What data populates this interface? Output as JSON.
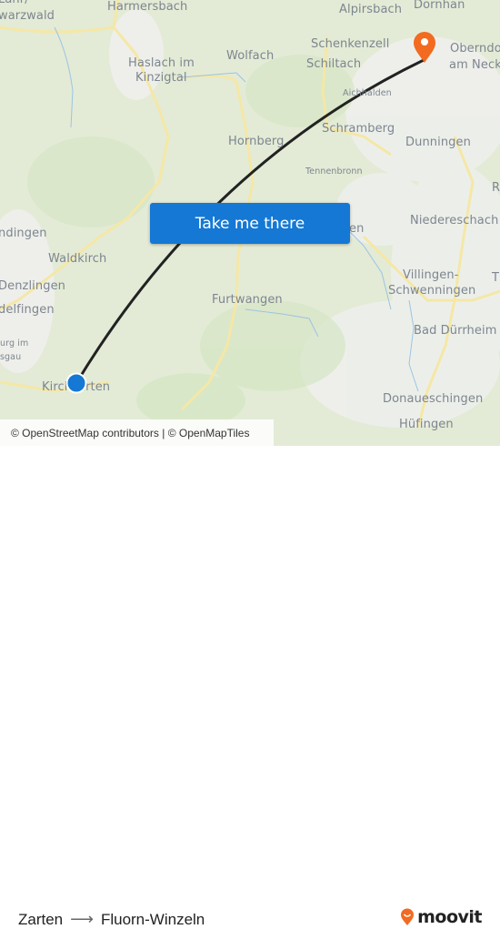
{
  "map": {
    "places": [
      {
        "id": "lahr",
        "text": "Lahr/"
      },
      {
        "id": "schwarzwald",
        "text": "warzwald"
      },
      {
        "id": "harmersbach",
        "text": "Harmersbach"
      },
      {
        "id": "haslach1",
        "text": "Haslach im"
      },
      {
        "id": "haslach2",
        "text": "Kinzigtal"
      },
      {
        "id": "wolfach",
        "text": "Wolfach"
      },
      {
        "id": "alpirsbach",
        "text": "Alpirsbach"
      },
      {
        "id": "dornhan",
        "text": "Dornhan"
      },
      {
        "id": "schenkenzell",
        "text": "Schenkenzell"
      },
      {
        "id": "schiltach",
        "text": "Schiltach"
      },
      {
        "id": "oberndorf1",
        "text": "Oberndo"
      },
      {
        "id": "oberndorf2",
        "text": "am Necka"
      },
      {
        "id": "aichhalden",
        "text": "Aichhalden"
      },
      {
        "id": "hornberg",
        "text": "Hornberg"
      },
      {
        "id": "schramberg",
        "text": "Schramberg"
      },
      {
        "id": "dunningen",
        "text": "Dunningen"
      },
      {
        "id": "tennenbronn",
        "text": "Tennenbronn"
      },
      {
        "id": "emmendingen",
        "text": "ndingen"
      },
      {
        "id": "waldkirch",
        "text": "Waldkirch"
      },
      {
        "id": "niedereschach",
        "text": "Niedereschach"
      },
      {
        "id": "koenigsfeld",
        "text": "en"
      },
      {
        "id": "r",
        "text": "R"
      },
      {
        "id": "denzlingen",
        "text": "Denzlingen"
      },
      {
        "id": "gundelfingen",
        "text": "delfingen"
      },
      {
        "id": "villingen1",
        "text": "Villingen-"
      },
      {
        "id": "villingen2",
        "text": "Schwenningen"
      },
      {
        "id": "t",
        "text": "T"
      },
      {
        "id": "furtwangen",
        "text": "Furtwangen"
      },
      {
        "id": "freiburg1",
        "text": "urg im"
      },
      {
        "id": "freiburg2",
        "text": "sgau"
      },
      {
        "id": "baddurrheim",
        "text": "Bad Dürrheim"
      },
      {
        "id": "kirchzarten",
        "text": "Kirchzarten"
      },
      {
        "id": "donaueschingen",
        "text": "Donaueschingen"
      },
      {
        "id": "hufingen",
        "text": "Hüfingen"
      }
    ],
    "origin_marker": {
      "icon": "origin-dot-icon",
      "color": "#1478d4"
    },
    "destination_marker": {
      "icon": "destination-pin-icon",
      "color": "#f26b21"
    },
    "route_line_color": "#222222"
  },
  "cta": {
    "label": "Take me there",
    "color": "#1478d4"
  },
  "attribution": {
    "text": "© OpenStreetMap contributors | © OpenMapTiles"
  },
  "footer": {
    "origin": "Zarten",
    "arrow_icon": "arrow-right-icon",
    "destination": "Fluorn-Winzeln",
    "brand": "moovit",
    "brand_color": "#f26b21"
  }
}
